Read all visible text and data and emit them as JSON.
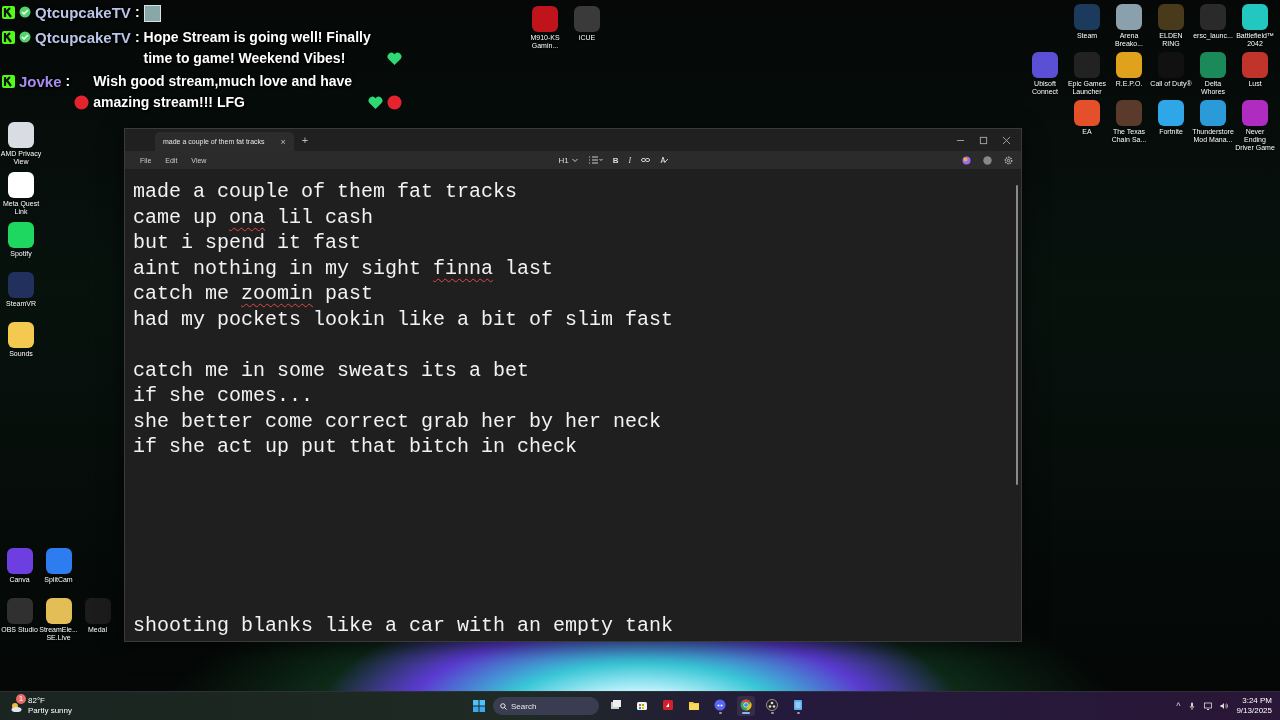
{
  "chat": [
    {
      "user": "QtcupcakeTV",
      "color": "#b9c4e6",
      "separator": ":",
      "parts": [
        {
          "kind": "emote"
        }
      ]
    },
    {
      "user": "QtcupcakeTV",
      "color": "#b9c4e6",
      "separator": ":",
      "parts": [
        {
          "kind": "text",
          "text": "Hope Stream is going well! Finally time to game! Weekend Vibes!"
        },
        {
          "kind": "green-heart"
        }
      ]
    },
    {
      "user": "Jovke",
      "color": "#a98bf0",
      "separator": ":",
      "parts": [
        {
          "kind": "red-circle"
        },
        {
          "kind": "text",
          "text": "Wish good stream,much love and have amazing stream!!! LFG"
        },
        {
          "kind": "green-heart"
        },
        {
          "kind": "red-circle"
        }
      ]
    }
  ],
  "desktop": {
    "top_icons": [
      {
        "label": "M910-KS Gamin...",
        "color": "#c0141c"
      },
      {
        "label": "iCUE",
        "color": "#3a3a3a"
      }
    ],
    "left_column": [
      {
        "label": "AMD Privacy View",
        "color": "#d9dde3"
      },
      {
        "label": "Meta Quest Link",
        "color": "#ffffff"
      },
      {
        "label": "Spotify",
        "color": "#1ed760"
      },
      {
        "label": "SteamVR",
        "color": "#22305e"
      },
      {
        "label": "Sounds",
        "color": "#f3c94f"
      }
    ],
    "left_bottom_rows": [
      [
        {
          "label": "Canva",
          "color": "#6d3fe0"
        },
        {
          "label": "SplitCam",
          "color": "#2d7cf0"
        }
      ],
      [
        {
          "label": "OBS Studio",
          "color": "#303030"
        },
        {
          "label": "StreamEle... SE.Live",
          "color": "#e3bd55"
        },
        {
          "label": "Medal",
          "color": "#1c1c1c"
        }
      ]
    ],
    "right_rows": [
      [
        {
          "label": "Steam",
          "color": "#1b3a5c"
        },
        {
          "label": "Arena Breako...",
          "color": "#8aa0ad"
        },
        {
          "label": "ELDEN RING",
          "color": "#4a3a1c"
        },
        {
          "label": "ersc_launc...",
          "color": "#2a2a2a"
        },
        {
          "label": "Battlefield™ 2042",
          "color": "#22c8c0"
        }
      ],
      [
        {
          "label": "Ubisoft Connect",
          "color": "#5b4fd6"
        },
        {
          "label": "Epic Games Launcher",
          "color": "#222222"
        },
        {
          "label": "R.E.P.O.",
          "color": "#e0a21c"
        },
        {
          "label": "Call of Duty®",
          "color": "#111111"
        },
        {
          "label": "Delta Whores",
          "color": "#1a8a5a"
        },
        {
          "label": "Lust",
          "color": "#c0342c"
        }
      ],
      [
        {
          "label": "EA",
          "color": "#e4502a"
        },
        {
          "label": "The Texas Chain Sa...",
          "color": "#5a3a2a"
        },
        {
          "label": "Fortnite",
          "color": "#2fa6e8"
        },
        {
          "label": "Thunderstore Mod Mana...",
          "color": "#2a9ad8"
        },
        {
          "label": "Never Ending Driver Game",
          "color": "#b02cc0"
        }
      ]
    ]
  },
  "notepad": {
    "tab": {
      "title": "made a couple of them fat tracks",
      "close": "×"
    },
    "new_tab": "+",
    "menus": [
      "File",
      "Edit",
      "View"
    ],
    "toolbar": {
      "heading": "H1",
      "bold": "B",
      "italic": "I"
    },
    "lines": [
      {
        "kind": "text",
        "segments": [
          {
            "text": "made a couple of them fat tracks",
            "misspelled": false
          }
        ]
      },
      {
        "kind": "text",
        "segments": [
          {
            "text": "came up ",
            "misspelled": false
          },
          {
            "text": "ona",
            "misspelled": true
          },
          {
            "text": " lil cash",
            "misspelled": false
          }
        ]
      },
      {
        "kind": "text",
        "segments": [
          {
            "text": "but i spend it fast",
            "misspelled": false
          }
        ]
      },
      {
        "kind": "text",
        "segments": [
          {
            "text": "aint nothing in my sight ",
            "misspelled": false
          },
          {
            "text": "finna",
            "misspelled": true
          },
          {
            "text": " last",
            "misspelled": false
          }
        ]
      },
      {
        "kind": "text",
        "segments": [
          {
            "text": "catch me ",
            "misspelled": false
          },
          {
            "text": "zoomin",
            "misspelled": true
          },
          {
            "text": " past",
            "misspelled": false
          }
        ]
      },
      {
        "kind": "text",
        "segments": [
          {
            "text": "had my pockets lookin like a bit of slim fast",
            "misspelled": false
          }
        ]
      },
      {
        "kind": "blank"
      },
      {
        "kind": "text",
        "segments": [
          {
            "text": "catch me in some sweats its a bet",
            "misspelled": false
          }
        ]
      },
      {
        "kind": "text",
        "segments": [
          {
            "text": "if she comes...",
            "misspelled": false
          }
        ]
      },
      {
        "kind": "text",
        "segments": [
          {
            "text": "she better come correct grab her by her neck",
            "misspelled": false
          }
        ]
      },
      {
        "kind": "text",
        "segments": [
          {
            "text": "if she act up put that bitch in check",
            "misspelled": false
          }
        ]
      },
      {
        "kind": "blank"
      },
      {
        "kind": "blank"
      },
      {
        "kind": "blank"
      },
      {
        "kind": "blank"
      },
      {
        "kind": "blank"
      },
      {
        "kind": "blank"
      },
      {
        "kind": "text",
        "segments": [
          {
            "text": "shooting blanks like a car with an empty tank",
            "misspelled": false
          }
        ]
      }
    ]
  },
  "taskbar": {
    "weather": {
      "badge": "1",
      "temperature": "82°F",
      "condition": "Partly sunny"
    },
    "search": {
      "placeholder": "Search"
    },
    "apps": [
      {
        "kind": "task-view",
        "running": false,
        "selected": false
      },
      {
        "kind": "store",
        "running": false,
        "selected": false
      },
      {
        "kind": "amd",
        "running": false,
        "selected": false
      },
      {
        "kind": "explorer",
        "running": false,
        "selected": false
      },
      {
        "kind": "discord",
        "running": true,
        "selected": false
      },
      {
        "kind": "chrome",
        "running": true,
        "selected": true
      },
      {
        "kind": "obs",
        "running": true,
        "selected": false
      },
      {
        "kind": "notepad",
        "running": true,
        "selected": false
      }
    ],
    "tray": {
      "overflow": "^",
      "time": "3:24 PM",
      "date": "9/13/2025"
    }
  }
}
